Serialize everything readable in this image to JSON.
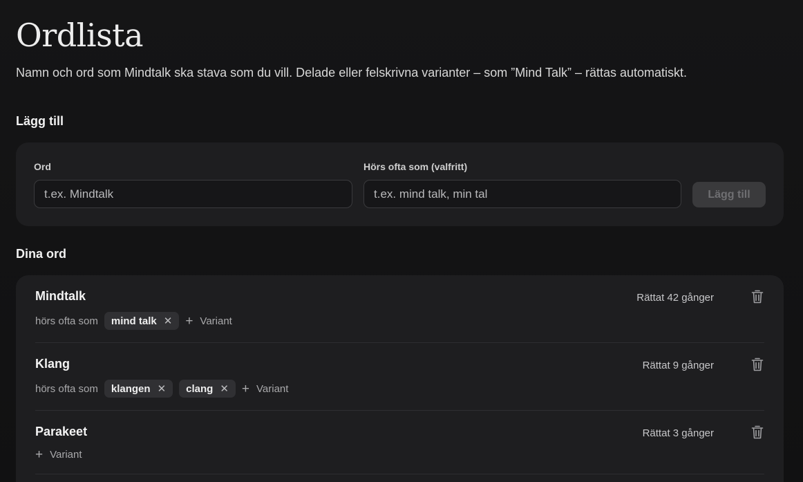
{
  "page": {
    "title": "Ordlista",
    "subtitle": "Namn och ord som Mindtalk ska stava som du vill. Delade eller felskrivna varianter – som ”Mind Talk” – rättas automatiskt."
  },
  "add_section": {
    "heading": "Lägg till",
    "word_label": "Ord",
    "word_placeholder": "t.ex. Mindtalk",
    "heard_label": "Hörs ofta som (valfritt)",
    "heard_placeholder": "t.ex. mind talk, min tal",
    "submit_label": "Lägg till"
  },
  "words_section": {
    "heading": "Dina ord",
    "heard_as_label": "hörs ofta som",
    "add_variant_label": "Variant",
    "items": [
      {
        "word": "Mindtalk",
        "corrected": "Rättat 42 gånger",
        "variants": [
          "mind talk"
        ]
      },
      {
        "word": "Klang",
        "corrected": "Rättat 9 gånger",
        "variants": [
          "klangen",
          "clang"
        ]
      },
      {
        "word": "Parakeet",
        "corrected": "Rättat 3 gånger",
        "variants": []
      }
    ]
  },
  "icons": {
    "delete": "trash-icon",
    "remove_variant": "close-icon",
    "add": "plus-icon"
  },
  "colors": {
    "background": "#111112",
    "card": "#1e1e20",
    "chip": "#303033",
    "disabled_button": "#3a3a3c"
  }
}
